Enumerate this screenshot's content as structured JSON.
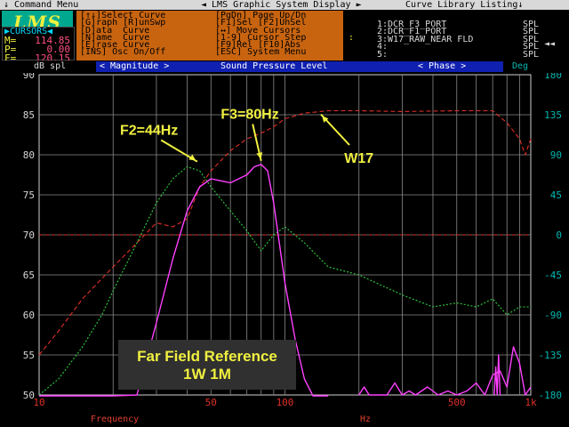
{
  "titlebar": {
    "left": "↓ Command Menu",
    "middle": "◄ LMS Graphic System Display ►",
    "right": "Curve Library Listing↓"
  },
  "logo": "LMS",
  "cursors": {
    "title": "▶CURSORS◀",
    "rows": [
      {
        "key": "M=",
        "value": "114.85"
      },
      {
        "key": "P=",
        "value": "0.00"
      },
      {
        "key": "F=",
        "value": "120.15"
      }
    ]
  },
  "menu": [
    [
      "[↑↓]Select Curve",
      "[PgDn] Page Up/Dn"
    ],
    [
      "[G]raph [R]unSwp",
      "[F1]Sel [F2]UnSel"
    ],
    [
      "[D]ata  Curve",
      "[↔] Move Cursors"
    ],
    [
      "[N]ame  Curve",
      "[1-9] Cursor Step"
    ],
    [
      "[E]rase Curve",
      "[F9]Rel [F10]Abs"
    ],
    [
      "[INS] Osc On/Off",
      "[ESC] System Menu"
    ]
  ],
  "library": [
    {
      "name": "1:DCR_F3_PORT",
      "type": "SPL"
    },
    {
      "name": "2:DCR_F1_PORT",
      "type": "SPL"
    },
    {
      "name": "3:W17_RAW_NEAR FLD",
      "type": "SPL"
    },
    {
      "name": "4:",
      "type": "SPL"
    },
    {
      "name": "5:",
      "type": "SPL"
    }
  ],
  "library_marker": ":",
  "library_arrow": "◄◄",
  "axisbar": {
    "left_unit": "dB spl",
    "magnitude_tab": "< Magnitude >",
    "title": "Sound Pressure Level",
    "phase_tab": "< Phase >",
    "right_unit": "Deg"
  },
  "bottom": {
    "xlabel": "Frequency",
    "hz": "Hz"
  },
  "colors": {
    "magnitude_axis": "#e03028",
    "phase_axis": "#00b8b0",
    "tab_bar": "#1020b0",
    "menu_bg": "#c86410",
    "logo_bg": "#00a890",
    "annotation": "#f0f040"
  },
  "chart_data": {
    "type": "line",
    "title": "Sound Pressure Level",
    "xlabel": "Frequency",
    "xunit": "Hz",
    "ylabel": "dB spl",
    "y2label": "Deg",
    "xscale": "log",
    "xlim": [
      10,
      1000
    ],
    "ylim": [
      50,
      90
    ],
    "y2lim": [
      -180,
      180
    ],
    "xticks": [
      10,
      50,
      100,
      500,
      1000
    ],
    "xticklabels": [
      "10",
      "50",
      "100",
      "500",
      "1k"
    ],
    "yticks": [
      50,
      55,
      60,
      65,
      70,
      75,
      80,
      85,
      90
    ],
    "y2ticks": [
      -180,
      -135,
      -90,
      -45,
      0,
      45,
      90,
      135,
      180
    ],
    "grid": true,
    "series": [
      {
        "color": "#e03028",
        "style": "dashed",
        "x": [
          10,
          12,
          15,
          20,
          25,
          30,
          35,
          40,
          45,
          50,
          60,
          70,
          80,
          90,
          100,
          120,
          150,
          200,
          300,
          500,
          700,
          800,
          900,
          950,
          1000
        ],
        "y": [
          55,
          58,
          62,
          66,
          69,
          71.5,
          71,
          72,
          76,
          78,
          80.5,
          82,
          82.7,
          83.5,
          84.5,
          85.2,
          85.5,
          85.5,
          85.4,
          85.5,
          85.5,
          84,
          82,
          80,
          82
        ]
      },
      {
        "color": "#30d040",
        "style": "dotted",
        "x": [
          10,
          12,
          15,
          18,
          20,
          25,
          30,
          35,
          40,
          45,
          50,
          60,
          70,
          80,
          90,
          100,
          120,
          150,
          200,
          300,
          400,
          500,
          600,
          700,
          800,
          900,
          1000
        ],
        "y": [
          50,
          52,
          56,
          60,
          63,
          69,
          74,
          77,
          78.5,
          78,
          76,
          73,
          70.5,
          68,
          70,
          71,
          69,
          66,
          65,
          62.5,
          61,
          61.5,
          61,
          62,
          60,
          61,
          61
        ]
      },
      {
        "color": "#ff40ff",
        "style": "solid",
        "x": [
          10,
          12,
          15,
          20,
          25,
          30,
          35,
          40,
          45,
          50,
          60,
          70,
          75,
          80,
          85,
          90,
          100,
          110,
          120,
          130,
          140,
          150
        ],
        "y": [
          40,
          40,
          40,
          42,
          50,
          59,
          67,
          73,
          76,
          77,
          76.5,
          77.5,
          78.5,
          78.8,
          78,
          74,
          64,
          57,
          52,
          48,
          45,
          42
        ]
      },
      {
        "color": "#ff40ff",
        "style": "solid",
        "x": [
          200,
          210,
          220,
          260,
          280,
          300,
          320,
          340,
          380,
          420,
          460,
          500,
          550,
          600,
          650,
          700,
          750,
          800,
          850,
          900,
          950,
          1000
        ],
        "y": [
          50,
          51,
          50,
          50,
          51.5,
          50,
          50.5,
          50,
          51,
          50,
          50.5,
          50,
          50.5,
          51.5,
          50,
          52.5,
          53,
          51,
          56,
          54,
          50,
          51
        ]
      },
      {
        "color": "#ff40ff",
        "style": "solid",
        "x": [
          710,
          720,
          730,
          740,
          750
        ],
        "y": [
          50,
          53.5,
          50,
          55,
          50
        ]
      }
    ],
    "annotations": [
      {
        "text": "F2=44Hz",
        "x": 44,
        "y": 78.7,
        "label_x": 28,
        "label_y": 82.5
      },
      {
        "text": "F3=80Hz",
        "x": 80,
        "y": 78.8,
        "label_x": 72,
        "label_y": 84.5
      },
      {
        "text": "W17",
        "x": 140,
        "y": 85.5,
        "label_x": 200,
        "label_y": 79
      }
    ],
    "reference_lines": [
      {
        "y": 70,
        "color": "#e03028",
        "style": "dashed"
      }
    ],
    "textbox": [
      "Far Field Reference",
      "1W 1M"
    ]
  }
}
